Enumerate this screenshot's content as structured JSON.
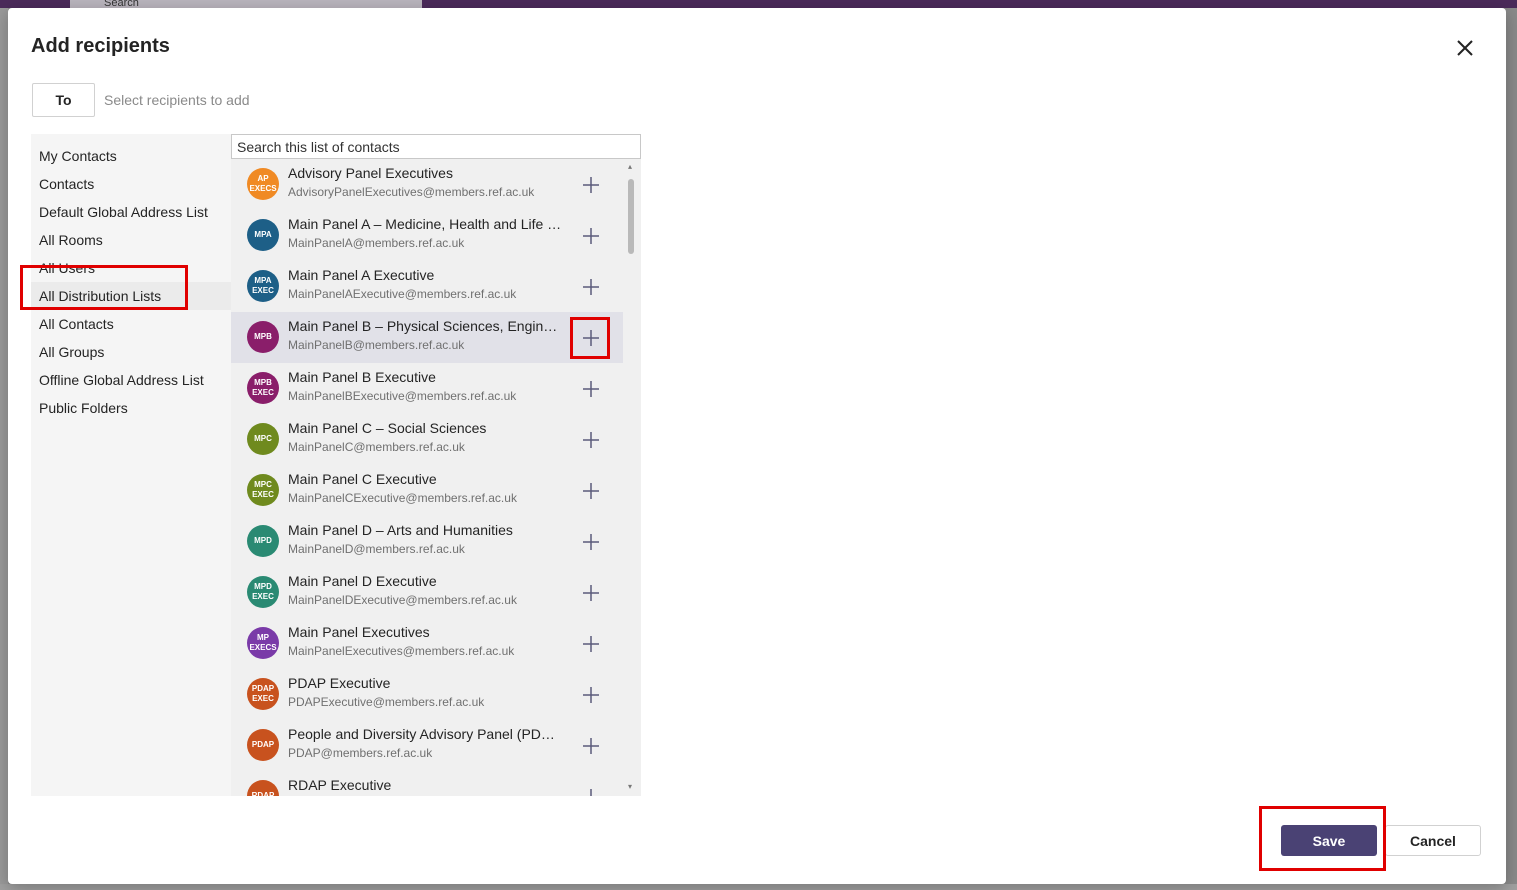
{
  "dialog": {
    "title": "Add recipients",
    "to_label": "To",
    "to_placeholder": "Select recipients to add",
    "search_placeholder": "Search this list of contacts",
    "save_label": "Save",
    "cancel_label": "Cancel"
  },
  "background": {
    "search_label": "Search"
  },
  "sidebar": {
    "items": [
      {
        "label": "My Contacts"
      },
      {
        "label": "Contacts"
      },
      {
        "label": "Default Global Address List"
      },
      {
        "label": "All Rooms"
      },
      {
        "label": "All Users"
      },
      {
        "label": "All Distribution Lists"
      },
      {
        "label": "All Contacts"
      },
      {
        "label": "All Groups"
      },
      {
        "label": "Offline Global Address List"
      },
      {
        "label": "Public Folders"
      }
    ],
    "selected_index": 5
  },
  "contacts": [
    {
      "name": "Advisory Panel Executives",
      "email": "AdvisoryPanelExecutives@members.ref.ac.uk",
      "initials": "AP\nEXECS",
      "color": "#f08a24"
    },
    {
      "name": "Main Panel A – Medicine, Health and Life Sciences",
      "email": "MainPanelA@members.ref.ac.uk",
      "initials": "MPA",
      "color": "#1d5f87"
    },
    {
      "name": "Main Panel A Executive",
      "email": "MainPanelAExecutive@members.ref.ac.uk",
      "initials": "MPA\nEXEC",
      "color": "#1d5f87"
    },
    {
      "name": "Main Panel B – Physical Sciences, Engineering and Mathematics",
      "email": "MainPanelB@members.ref.ac.uk",
      "initials": "MPB",
      "color": "#8a1e6a"
    },
    {
      "name": "Main Panel B Executive",
      "email": "MainPanelBExecutive@members.ref.ac.uk",
      "initials": "MPB\nEXEC",
      "color": "#8a1e6a"
    },
    {
      "name": "Main Panel C – Social Sciences",
      "email": "MainPanelC@members.ref.ac.uk",
      "initials": "MPC",
      "color": "#6f8a1e"
    },
    {
      "name": "Main Panel C Executive",
      "email": "MainPanelCExecutive@members.ref.ac.uk",
      "initials": "MPC\nEXEC",
      "color": "#6f8a1e"
    },
    {
      "name": "Main Panel D – Arts and Humanities",
      "email": "MainPanelD@members.ref.ac.uk",
      "initials": "MPD",
      "color": "#2a8a73"
    },
    {
      "name": "Main Panel D Executive",
      "email": "MainPanelDExecutive@members.ref.ac.uk",
      "initials": "MPD\nEXEC",
      "color": "#2a8a73"
    },
    {
      "name": "Main Panel Executives",
      "email": "MainPanelExecutives@members.ref.ac.uk",
      "initials": "MP\nEXECS",
      "color": "#7a3aa8"
    },
    {
      "name": "PDAP Executive",
      "email": "PDAPExecutive@members.ref.ac.uk",
      "initials": "PDAP\nEXEC",
      "color": "#c8521e"
    },
    {
      "name": "People and Diversity Advisory Panel (PDAP)",
      "email": "PDAP@members.ref.ac.uk",
      "initials": "PDAP",
      "color": "#c8521e"
    },
    {
      "name": "RDAP Executive",
      "email": "",
      "initials": "RDAP",
      "color": "#c8521e"
    }
  ],
  "hovered_index": 3,
  "colors": {
    "primary": "#4a4274",
    "highlight": "#e00000"
  }
}
